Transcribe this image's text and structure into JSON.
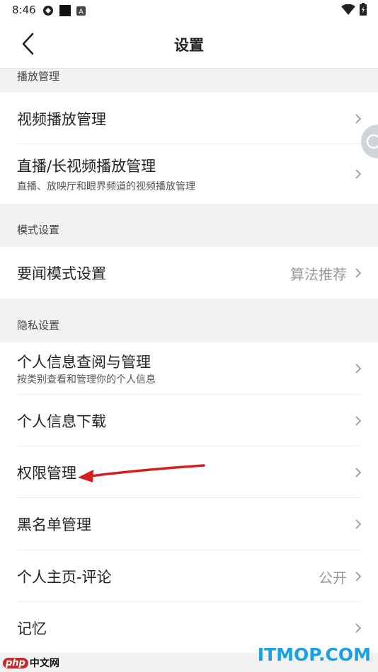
{
  "status_bar": {
    "time": "8:46"
  },
  "header": {
    "title": "设置"
  },
  "sections": {
    "playback": {
      "title": "播放管理",
      "items": [
        {
          "label": "视频播放管理"
        },
        {
          "label": "直播/长视频播放管理",
          "subtitle": "直播、放映厅和眼界频道的视频播放管理"
        }
      ]
    },
    "mode": {
      "title": "模式设置",
      "items": [
        {
          "label": "要闻模式设置",
          "value": "算法推荐"
        }
      ]
    },
    "privacy": {
      "title": "隐私设置",
      "items": [
        {
          "label": "个人信息查阅与管理",
          "subtitle": "按类别查看和管理你的个人信息"
        },
        {
          "label": "个人信息下载"
        },
        {
          "label": "权限管理"
        },
        {
          "label": "黑名单管理"
        },
        {
          "label": "个人主页-评论",
          "value": "公开"
        },
        {
          "label": "记忆"
        }
      ]
    }
  },
  "watermarks": {
    "left_badge": "php",
    "left_text": "中文网",
    "right_text": "ITMOP.COM"
  },
  "colors": {
    "annotation_arrow": "#d62020",
    "brand_right": "#1aa0e6"
  }
}
